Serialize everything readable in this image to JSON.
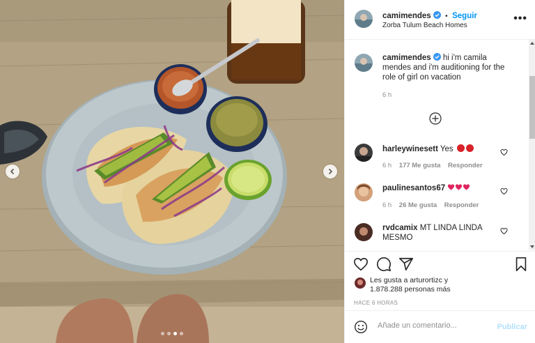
{
  "header": {
    "username": "camimendes",
    "separator": "•",
    "follow_label": "Seguir",
    "location": "Zorba Tulum Beach Homes",
    "more_label": "•••"
  },
  "caption": {
    "username": "camimendes",
    "text": "hi i'm camila mendes and i'm auditioning for the role of girl on vacation",
    "age": "6 h"
  },
  "comments": [
    {
      "username": "harleywinesett",
      "text": "Yes",
      "age": "6 h",
      "likes": "177 Me gusta",
      "reply": "Responder",
      "emoji_count": 2
    },
    {
      "username": "paulinesantos67",
      "text": "",
      "age": "6 h",
      "likes": "26 Me gusta",
      "reply": "Responder",
      "emoji_hearts": 3
    },
    {
      "username": "rvdcamix",
      "text": "MT LINDA LINDA MESMO"
    }
  ],
  "likes": {
    "prefix": "Les gusta a ",
    "user": "arturortizc",
    "mid": " y",
    "count": "1.878.288 personas más"
  },
  "timestamp": "HACE 6 HORAS",
  "add_comment": {
    "placeholder": "Añade un comentario...",
    "publish_label": "Publicar"
  },
  "colors": {
    "accent": "#0095f6",
    "heart": "#ed4956",
    "publish_disabled": "#b2dffc"
  },
  "icons": [
    "heart-icon",
    "comment-icon",
    "share-icon",
    "bookmark-icon",
    "emoji-icon",
    "more-icon",
    "verified-icon",
    "load-more-icon",
    "chevron-left-icon",
    "chevron-right-icon"
  ]
}
